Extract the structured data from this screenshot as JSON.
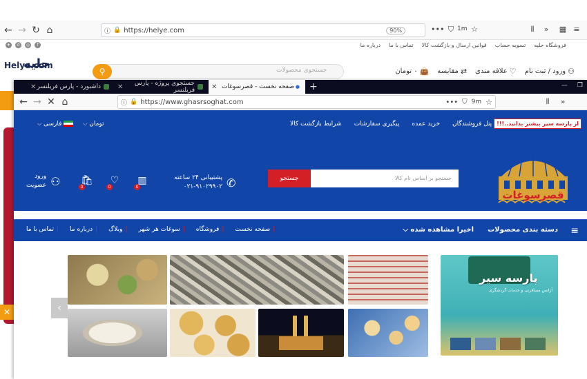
{
  "back_browser": {
    "url": "https://helye.com",
    "zoom": "90%",
    "toolbar_counter": "1m",
    "top_links": [
      "فروشگاه حلیه",
      "تسویه حساب",
      "قوانین ارسال و بازگشت کالا",
      "تماس با ما",
      "درباره ما"
    ],
    "logo_latin": "Helye.com",
    "logo_persian": "حلیه",
    "search_placeholder": "جستجوی محصولات",
    "header_actions": {
      "login": "ورود / ثبت نام",
      "wishlist": "علاقه مندی",
      "compare": "مقایسه",
      "cart": "۰ تومان"
    },
    "close_glyph": "✕"
  },
  "front_browser": {
    "tabs": [
      {
        "title": "صفحه نخست - قصرسوغات",
        "active": true
      },
      {
        "title": "جستجوی پروژه - پارس فریلنسر",
        "active": false
      },
      {
        "title": "داشبورد - پارس فریلنسر",
        "active": false
      }
    ],
    "url": "https://www.ghasrsoghat.com",
    "toolbar_counter": "9m"
  },
  "site": {
    "promo": "از پارسه سیر بیشتر بدانید..!!!",
    "top_nav": [
      "پنل فروشندگان",
      "خرید عمده",
      "پیگیری سفارشات",
      "شرایط بازگشت کالا"
    ],
    "currency": "تومان",
    "language": "فارسی",
    "logo_text": "قصرسوغات",
    "search_placeholder": "جستجو بر اساس نام کالا",
    "search_button": "جستجو",
    "support_label": "پشتیبانی ۲۴ ساعته",
    "support_phone": "۰۲۱-۹۱۰۲۹۹۰۲",
    "login_label": "ورود",
    "register_label": "عضویت",
    "badges": {
      "compare": "0",
      "wishlist": "0",
      "cart": "0"
    },
    "categories_label": "دسته بندی محصولات",
    "recent_label": "اخیرا مشاهده شده",
    "main_links": [
      "صفحه نخست",
      "فروشگاه",
      "سوغات هر شهر",
      "وبلاگ",
      "درباره ما",
      "تماس با ما"
    ],
    "banner_title": "پارسه سیر",
    "banner_subtitle": "آژانس مسافرتی و خدمات گردشگری"
  },
  "colors": {
    "brand_blue": "#1245a8",
    "accent_red": "#d32027",
    "helye_orange": "#f39c12",
    "helye_red": "#b3182f"
  },
  "icons": {
    "back": "arrow-left-icon",
    "forward": "arrow-right-icon",
    "reload": "reload-icon",
    "home": "home-icon",
    "lock": "lock-icon",
    "star": "star-icon",
    "library": "library-icon",
    "menu": "hamburger-icon"
  }
}
